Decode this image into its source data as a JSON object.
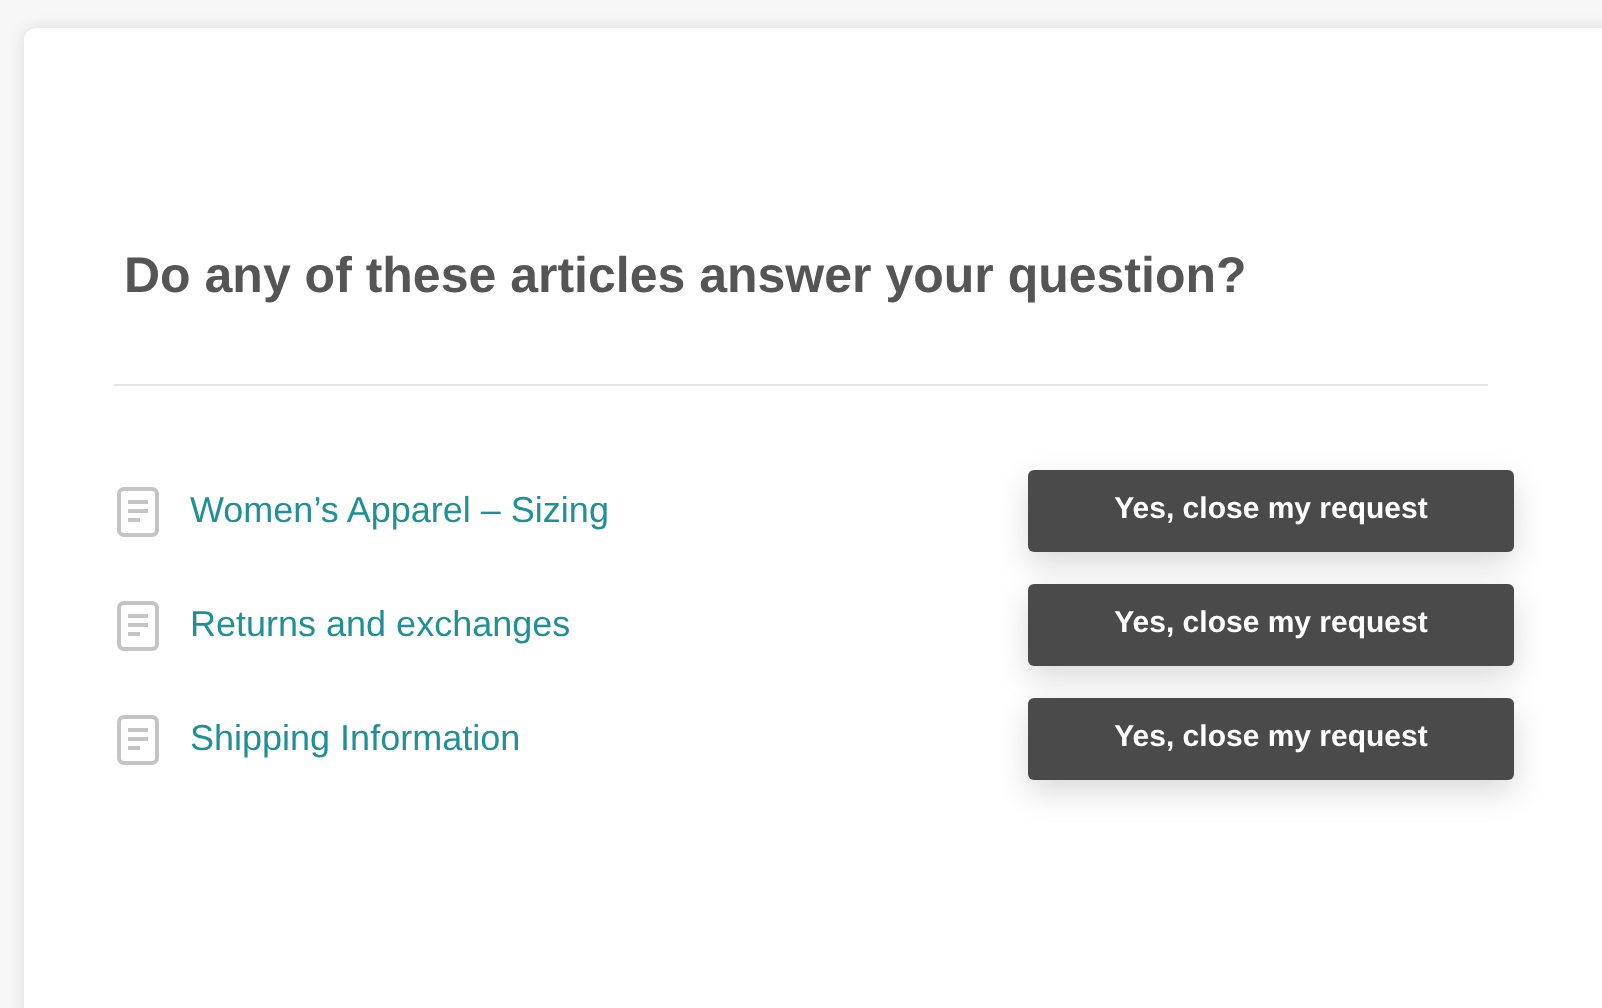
{
  "title": "Do any of these articles answer your question?",
  "articles": [
    {
      "label": "Women’s Apparel – Sizing",
      "button": "Yes, close my request"
    },
    {
      "label": "Returns and exchanges",
      "button": "Yes, close my request"
    },
    {
      "label": "Shipping Information",
      "button": "Yes, close my request"
    }
  ]
}
